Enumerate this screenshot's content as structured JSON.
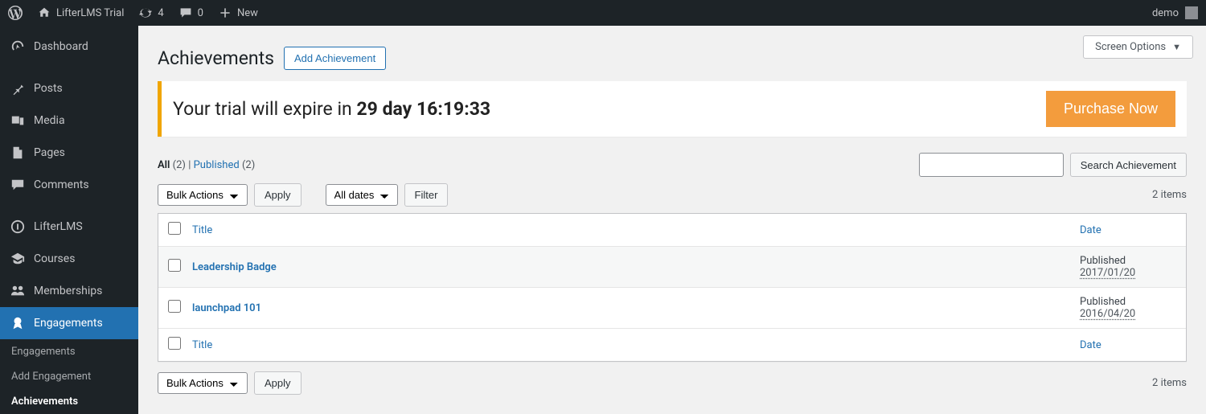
{
  "adminbar": {
    "site_name": "LifterLMS Trial",
    "updates_count": "4",
    "comments_count": "0",
    "new_label": "New",
    "user_name": "demo"
  },
  "sidebar": {
    "items": [
      {
        "label": "Dashboard"
      },
      {
        "label": "Posts"
      },
      {
        "label": "Media"
      },
      {
        "label": "Pages"
      },
      {
        "label": "Comments"
      },
      {
        "label": "LifterLMS"
      },
      {
        "label": "Courses"
      },
      {
        "label": "Memberships"
      },
      {
        "label": "Engagements"
      }
    ],
    "submenu": [
      {
        "label": "Engagements"
      },
      {
        "label": "Add Engagement"
      },
      {
        "label": "Achievements"
      }
    ]
  },
  "header": {
    "title": "Achievements",
    "add_label": "Add Achievement",
    "screen_options": "Screen Options"
  },
  "trial": {
    "prefix": "Your trial will expire in ",
    "time": "29 day 16:19:33",
    "purchase": "Purchase Now"
  },
  "status": {
    "all_label": "All",
    "all_count": "(2)",
    "sep": "  |  ",
    "published_label": "Published",
    "published_count": "(2)"
  },
  "search": {
    "button": "Search Achievement"
  },
  "bulk": {
    "label": "Bulk Actions",
    "apply": "Apply",
    "dates": "All dates",
    "filter": "Filter"
  },
  "table": {
    "title_col": "Title",
    "date_col": "Date",
    "rows": [
      {
        "title": "Leadership Badge",
        "status": "Published",
        "date": "2017/01/20"
      },
      {
        "title": "launchpad 101",
        "status": "Published",
        "date": "2016/04/20"
      }
    ]
  },
  "items_count": "2 items"
}
